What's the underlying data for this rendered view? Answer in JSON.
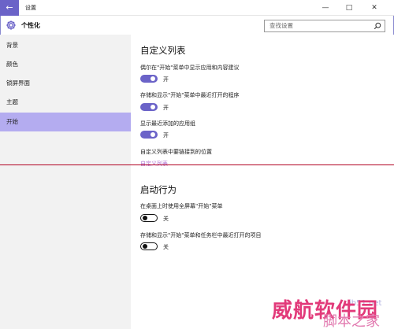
{
  "window": {
    "title": "设置",
    "back_glyph": "←",
    "minimize_glyph": "—",
    "maximize_glyph": "□",
    "close_glyph": "✕"
  },
  "header": {
    "title": "个性化",
    "icon": "gear-icon"
  },
  "search": {
    "placeholder": "查找设置",
    "icon": "search-icon"
  },
  "sidebar": {
    "items": [
      {
        "label": "背景",
        "active": false
      },
      {
        "label": "颜色",
        "active": false
      },
      {
        "label": "锁屏界面",
        "active": false
      },
      {
        "label": "主题",
        "active": false
      },
      {
        "label": "开始",
        "active": true
      }
    ]
  },
  "main": {
    "custom_list": {
      "title": "自定义列表",
      "settings": [
        {
          "label": "偶尔在\"开始\"菜单中显示应用和内容建议",
          "state": "开",
          "on": true
        },
        {
          "label": "存储和显示\"开始\"菜单中最近打开的程序",
          "state": "开",
          "on": true
        },
        {
          "label": "显示最近添加的应用组",
          "state": "开",
          "on": true
        }
      ],
      "link_caption": "自定义列表中要链接到的位置",
      "link_text": "自定义列表"
    },
    "startup": {
      "title": "启动行为",
      "settings": [
        {
          "label": "在桌面上时使用全屏幕\"开始\"菜单",
          "state": "关",
          "on": false
        },
        {
          "label": "存储和显示\"开始\"菜单和任务栏中最近打开的项目",
          "state": "关",
          "on": false
        }
      ]
    }
  },
  "watermark": {
    "url": "jb51.net",
    "main": "威航软件园",
    "sub": "脚本之家"
  },
  "colors": {
    "accent": "#6b63c8",
    "sidebar_active": "#b4acf0",
    "sidebar_bg": "#f2f2f2",
    "link": "#b070d0"
  }
}
